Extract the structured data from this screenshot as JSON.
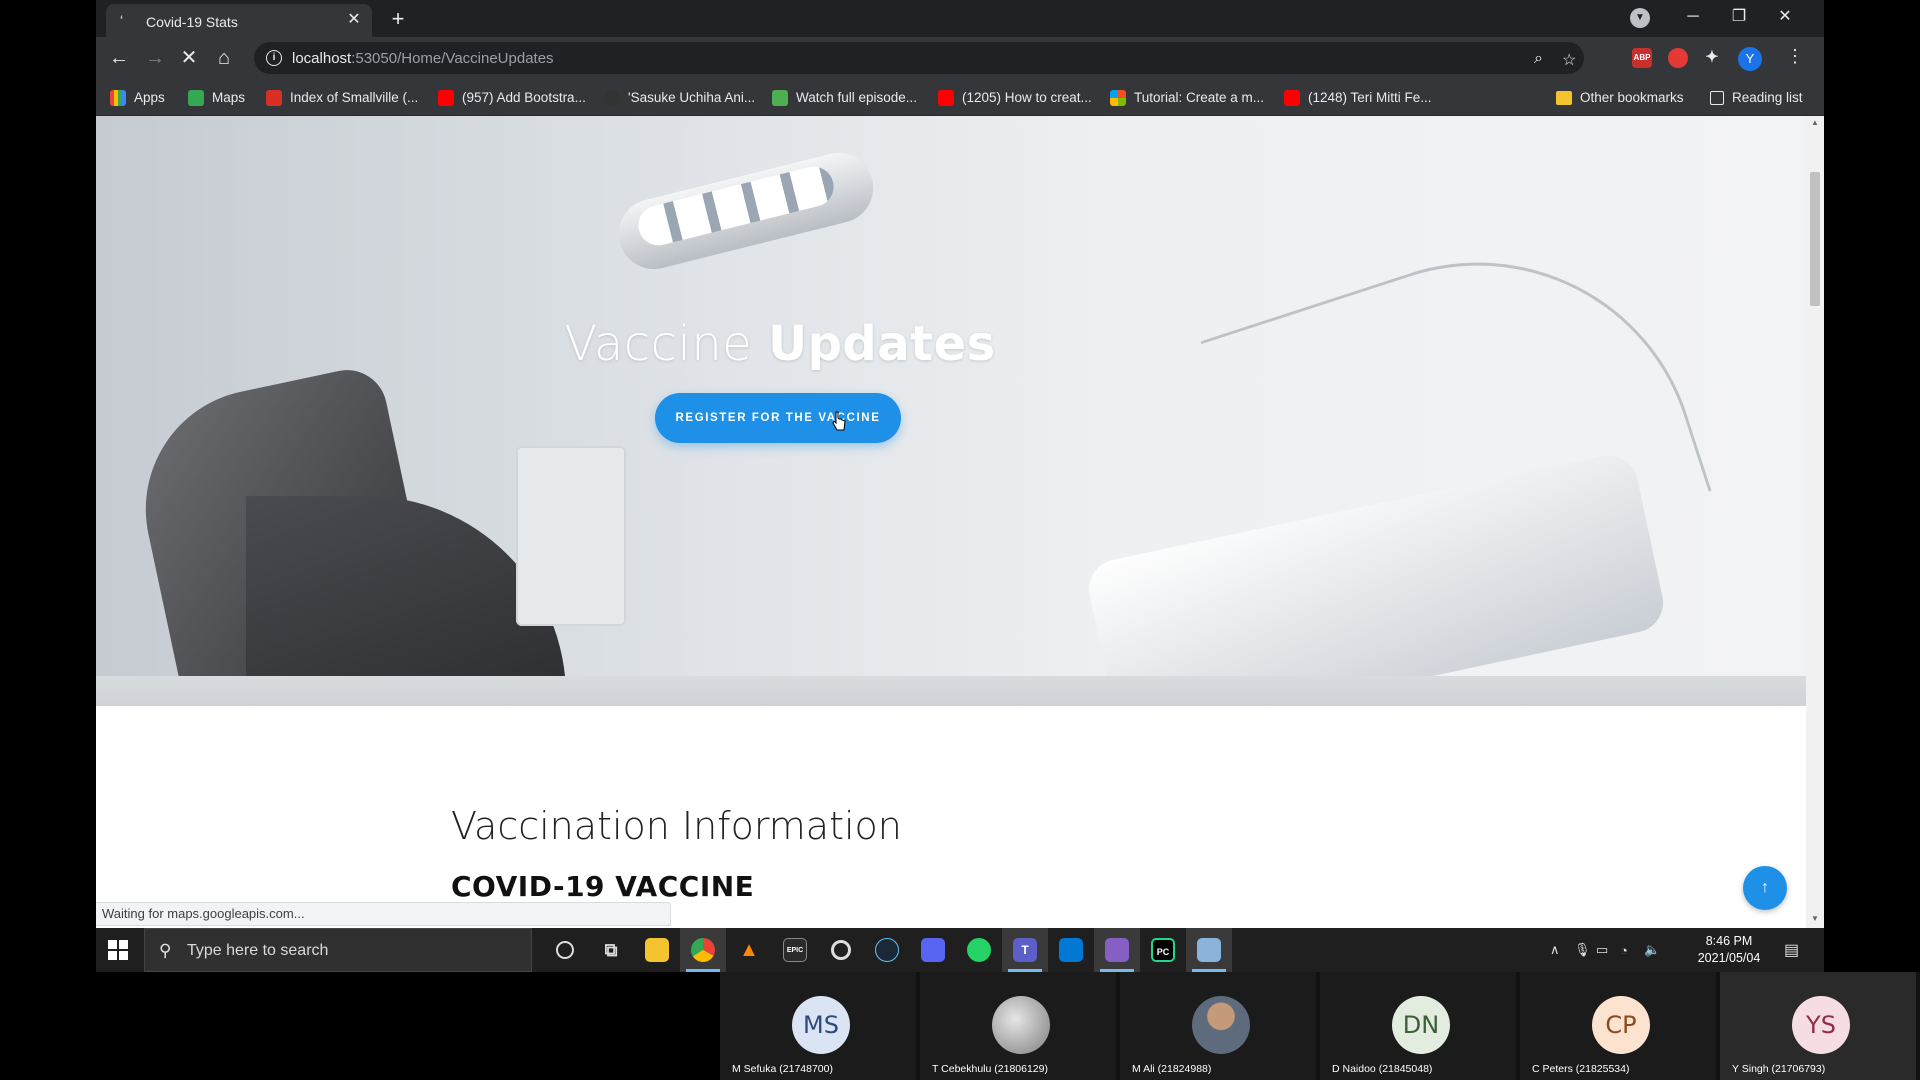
{
  "browser": {
    "tab_title": "Covid-19 Stats",
    "url_host": "localhost",
    "url_path": ":53050/Home/VaccineUpdates",
    "profile_initial": "Y",
    "abp_label": "ABP"
  },
  "bookmarks": {
    "items": [
      {
        "label": "Apps",
        "icon_color": "#e8453c"
      },
      {
        "label": "Maps",
        "icon_color": "#34a853"
      },
      {
        "label": "Index of Smallville (...",
        "icon_color": "#d93025"
      },
      {
        "label": "(957) Add Bootstra...",
        "icon_color": "#ff0000"
      },
      {
        "label": "'Sasuke Uchiha Ani...",
        "icon_color": "#333333"
      },
      {
        "label": "Watch full episode...",
        "icon_color": "#4caf50"
      },
      {
        "label": "(1205) How to creat...",
        "icon_color": "#ff0000"
      },
      {
        "label": "Tutorial: Create a m...",
        "icon_color": "#f25022"
      },
      {
        "label": "(1248) Teri Mitti Fe...",
        "icon_color": "#ff0000"
      }
    ],
    "other": "Other bookmarks",
    "reading": "Reading list"
  },
  "page": {
    "hero_title_light": "Vaccine",
    "hero_title_bold": "Updates",
    "register_button": "REGISTER FOR THE VACCINE",
    "info_heading": "Vaccination Information",
    "vaccine_heading": "COVID-19 VACCINE",
    "accent_color": "#1e90e8"
  },
  "status": {
    "text": "Waiting for maps.googleapis.com..."
  },
  "taskbar": {
    "search_placeholder": "Type here to search",
    "time": "8:46 PM",
    "date": "2021/05/04"
  },
  "participants": [
    {
      "initials": "MS",
      "name": "M Sefuka (21748700)",
      "bg": "#dbe4f3",
      "fg": "#2d4a80"
    },
    {
      "initials": "",
      "name": "T Cebekhulu (21806129)",
      "bg": "#9a9a9a",
      "fg": "#ffffff"
    },
    {
      "initials": "",
      "name": "M Ali (21824988)",
      "bg": "#6b7a8a",
      "fg": "#ffffff"
    },
    {
      "initials": "DN",
      "name": "D Naidoo (21845048)",
      "bg": "#e2ecdf",
      "fg": "#3f5e3a"
    },
    {
      "initials": "CP",
      "name": "C Peters (21825534)",
      "bg": "#fbe3cf",
      "fg": "#8a4a1d"
    },
    {
      "initials": "YS",
      "name": "Y Singh (21706793)",
      "bg": "#f6dde3",
      "fg": "#8a2f45"
    }
  ]
}
